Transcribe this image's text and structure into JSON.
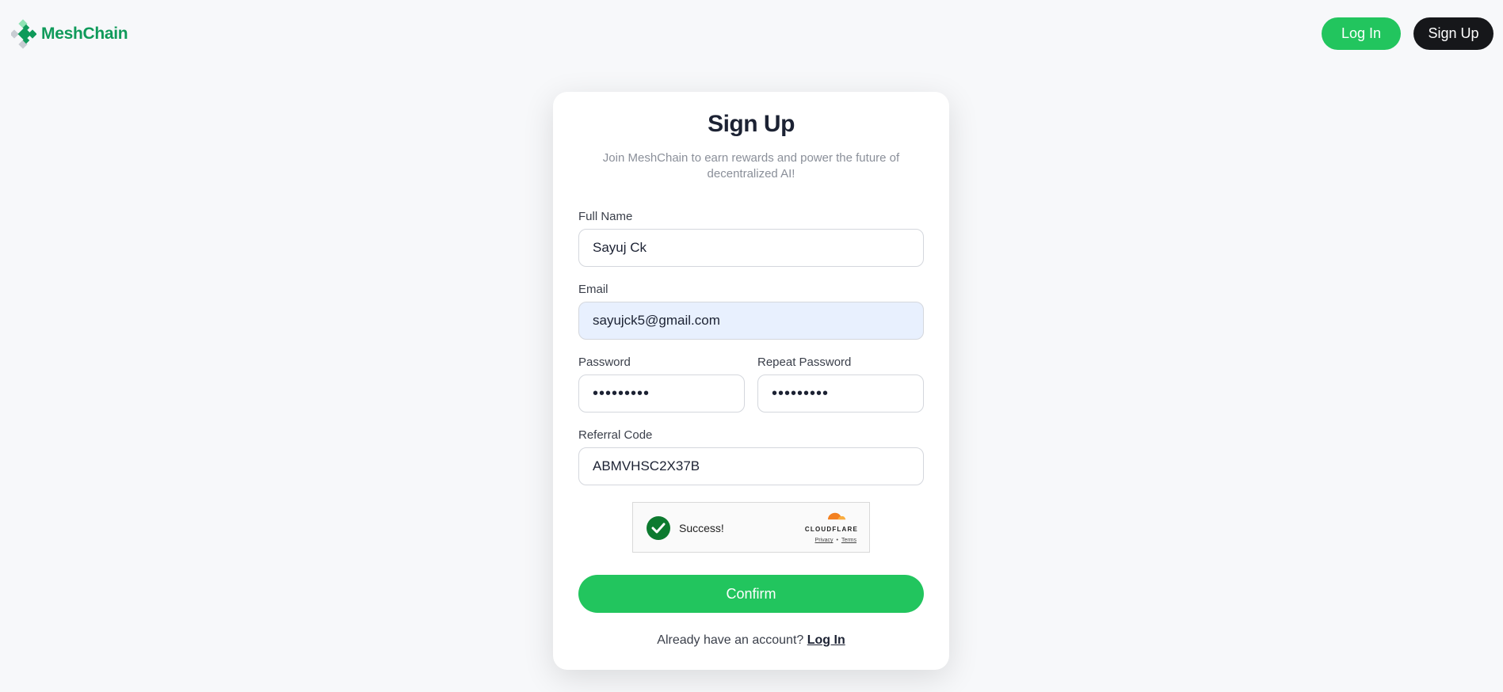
{
  "brand": {
    "name": "MeshChain",
    "color": "#0f9a5a"
  },
  "header": {
    "login_label": "Log In",
    "signup_label": "Sign Up"
  },
  "form": {
    "title": "Sign Up",
    "subtitle": "Join MeshChain to earn rewards and power the future of decentralized AI!",
    "full_name": {
      "label": "Full Name",
      "value": "Sayuj Ck"
    },
    "email": {
      "label": "Email",
      "value": "sayujck5@gmail.com"
    },
    "password": {
      "label": "Password",
      "value": "•••••••••"
    },
    "repeat_password": {
      "label": "Repeat Password",
      "value": "•••••••••"
    },
    "referral": {
      "label": "Referral Code",
      "value": "ABMVHSC2X37B"
    },
    "confirm_label": "Confirm",
    "footer_text": "Already have an account?",
    "footer_link": "Log In"
  },
  "captcha": {
    "status": "Success!",
    "brand": "CLOUDFLARE",
    "privacy": "Privacy",
    "separator": "•",
    "terms": "Terms"
  },
  "colors": {
    "accent": "#22c55e",
    "dark_button": "#16171a",
    "autofill": "#e8f0fe"
  }
}
